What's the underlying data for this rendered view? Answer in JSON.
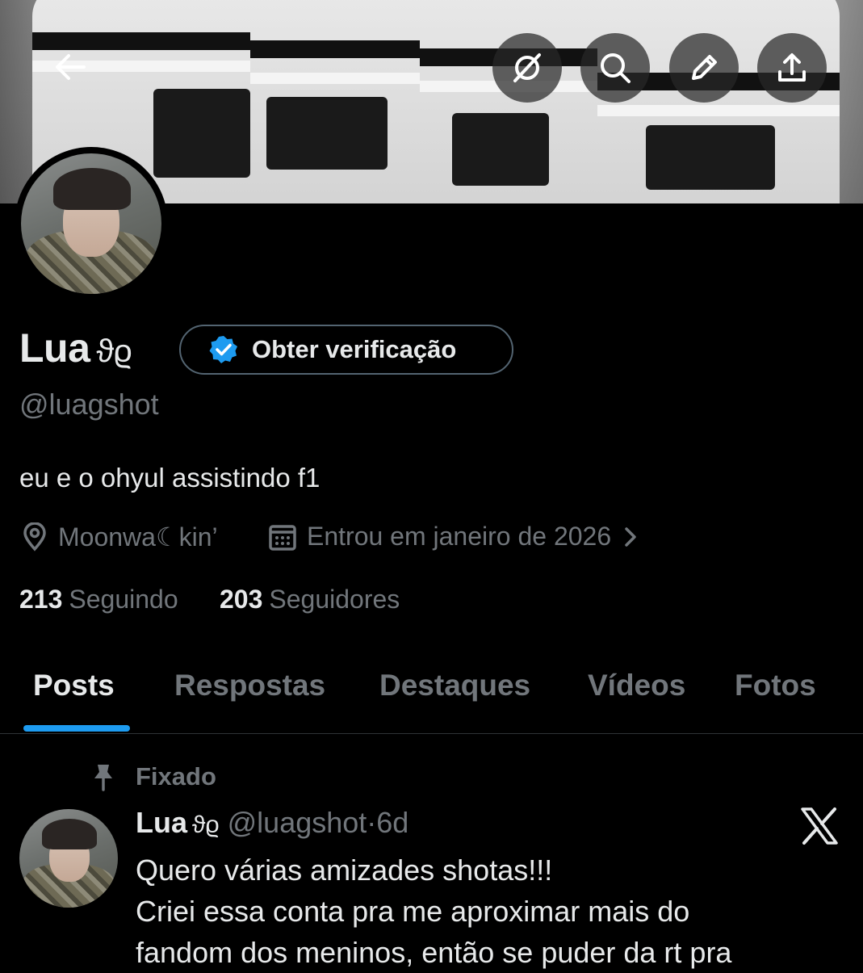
{
  "header": {
    "back_icon": "arrow-left-icon",
    "actions": [
      "grok-icon",
      "search-icon",
      "edit-icon",
      "share-icon"
    ]
  },
  "profile": {
    "name": "Lua",
    "name_glyph": "ϑϱ",
    "verify_button": "Obter verificação",
    "handle": "@luagshot",
    "bio": "eu e o ohyul assistindo f1",
    "location": "Moonwa☾kin’",
    "joined": "Entrou em janeiro de 2026",
    "following_count": "213",
    "following_label": "Seguindo",
    "followers_count": "203",
    "followers_label": "Seguidores"
  },
  "tabs": [
    "Posts",
    "Respostas",
    "Destaques",
    "Vídeos",
    "Fotos"
  ],
  "active_tab": "Posts",
  "pinned_post": {
    "pinned_label": "Fixado",
    "author": "Lua",
    "author_glyph": "ϑϱ",
    "handle": "@luagshot",
    "separator": "·",
    "age": "6d",
    "lines": [
      "Quero várias amizades shotas!!!",
      "Criei essa conta pra me aproximar mais do",
      "fandom dos meninos, então se puder da rt pra"
    ]
  },
  "colors": {
    "accent": "#1d9bf0",
    "background": "#000000",
    "text_primary": "#e7e9ea",
    "text_secondary": "#71767b",
    "border": "#2f3336"
  }
}
